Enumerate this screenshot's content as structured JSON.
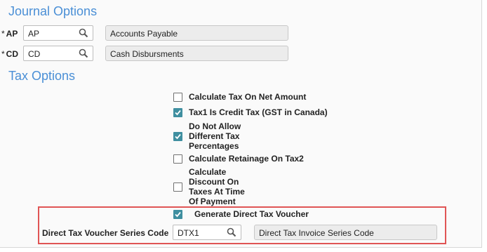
{
  "journal": {
    "title": "Journal Options",
    "ap": {
      "required": "*",
      "label": "AP",
      "value": "AP",
      "description": "Accounts Payable"
    },
    "cd": {
      "required": "*",
      "label": "CD",
      "value": "CD",
      "description": "Cash Disbursments"
    }
  },
  "tax": {
    "title": "Tax Options",
    "options": [
      {
        "label": "Calculate Tax On Net Amount",
        "checked": false
      },
      {
        "label": "Tax1 Is Credit Tax (GST in Canada)",
        "checked": true
      },
      {
        "label": "Do Not Allow Different Tax Percentages",
        "checked": true
      },
      {
        "label": "Calculate Retainage On Tax2",
        "checked": false
      },
      {
        "label": "Calculate Discount On Taxes At Time Of Payment",
        "checked": false
      },
      {
        "label": "Generate Direct Tax Voucher",
        "checked": true
      }
    ],
    "series": {
      "label": "Direct Tax Voucher Series Code",
      "value": "DTX1",
      "description": "Direct Tax Invoice Series Code"
    }
  },
  "colors": {
    "accent": "#4a8fd6",
    "check": "#3f8fa0",
    "highlight": "#e05555"
  },
  "icons": {
    "lookup": "search-icon",
    "checkbox": "check-icon"
  }
}
